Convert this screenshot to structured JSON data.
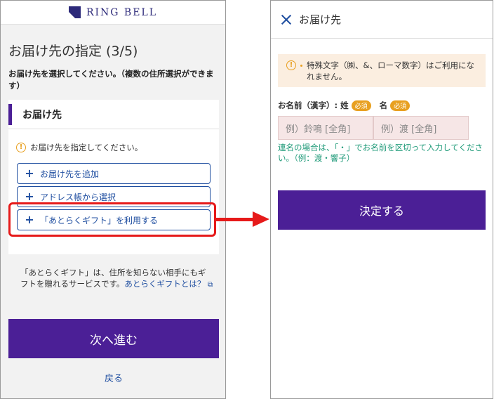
{
  "left": {
    "logo_text": "RING BELL",
    "page_title": "お届け先の指定 (3/5)",
    "description": "お届け先を選択してください。（複数の住所選択ができます）",
    "card_title": "お届け先",
    "notice": "お届け先を指定してください。",
    "options": [
      {
        "label": "お届け先を追加",
        "icon": "plus-icon"
      },
      {
        "label": "アドレス帳から選択",
        "icon": "plus-icon"
      },
      {
        "label": "「あとらくギフト」を利用する",
        "icon": "plus-icon"
      }
    ],
    "intro_text": "「あとらくギフト」は、住所を知らない相手にもギフトを贈れるサービスです。",
    "intro_link": "あとらくギフトとは？",
    "next_button": "次へ進む",
    "back_link": "戻る"
  },
  "right": {
    "title": "お届け先",
    "alert": "特殊文字（㈱、&、ローマ数字）はご利用になれません。",
    "last_name_label": "お名前（漢字）: 姓",
    "first_name_label": "名",
    "required_badge": "必須",
    "last_name_placeholder": "例）鈴鳴 [全角]",
    "first_name_placeholder": "例）渡 [全角]",
    "hint": "連名の場合は、「・」でお名前を区切って入力してください。（例：渡・響子）",
    "submit_button": "決定する"
  },
  "colors": {
    "brand_purple": "#4b1f96",
    "link_blue": "#1f4ea0",
    "highlight_red": "#e61a1a",
    "warning_orange": "#e8a020",
    "hint_green": "#1e9a78"
  }
}
